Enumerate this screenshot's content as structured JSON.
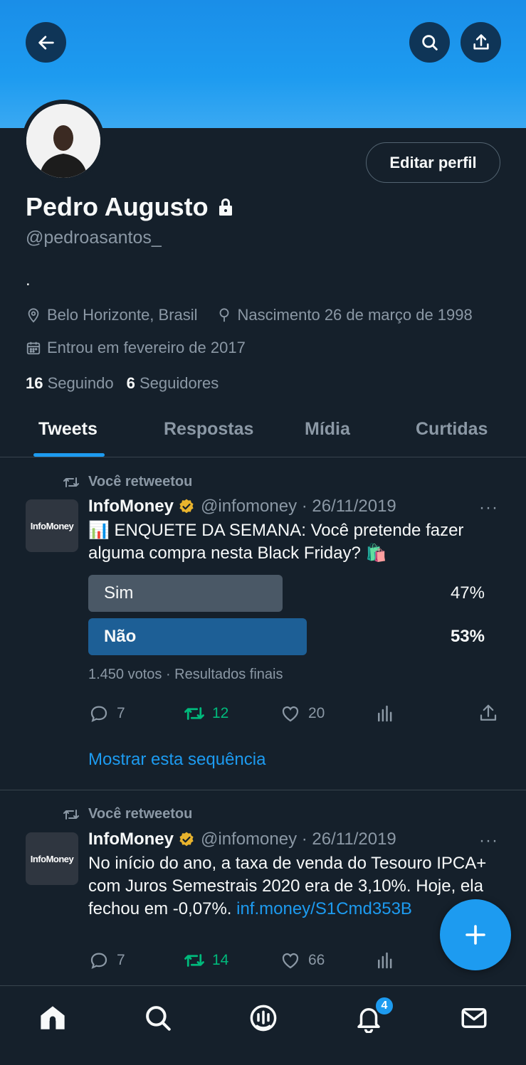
{
  "profile": {
    "name": "Pedro Augusto",
    "handle": "@pedroasantos_",
    "bio": ".",
    "location": "Belo Horizonte, Brasil",
    "birthday": "Nascimento 26 de março de 1998",
    "joined": "Entrou em fevereiro de 2017",
    "following_count": "16",
    "following_label": "Seguindo",
    "followers_count": "6",
    "followers_label": "Seguidores",
    "edit_label": "Editar perfil"
  },
  "tabs": [
    {
      "label": "Tweets",
      "active": true
    },
    {
      "label": "Respostas",
      "active": false
    },
    {
      "label": "Mídia",
      "active": false
    },
    {
      "label": "Curtidas",
      "active": false
    }
  ],
  "tweets": [
    {
      "retweet_label": "Você retweetou",
      "avatar_text": "InfoMoney",
      "author": "InfoMoney",
      "meta": "@infomoney · 26/11/2019",
      "more": "···",
      "text": "📊 ENQUETE DA SEMANA: Você pretende fazer alguma compra nesta Black Friday? 🛍️",
      "poll": {
        "options": [
          {
            "label": "Sim",
            "percent_label": "47%",
            "fraction": 0.47,
            "winner": false
          },
          {
            "label": "Não",
            "percent_label": "53%",
            "fraction": 0.53,
            "winner": true
          }
        ],
        "footer": "1.450 votos · Resultados finais"
      },
      "replies": "7",
      "retweets": "12",
      "likes": "20",
      "show_thread": "Mostrar esta sequência"
    },
    {
      "retweet_label": "Você retweetou",
      "avatar_text": "InfoMoney",
      "author": "InfoMoney",
      "meta": "@infomoney · 26/11/2019",
      "more": "···",
      "text": "No início do ano, a taxa de venda do Tesouro IPCA+ com Juros Semestrais 2020 era de 3,10%. Hoje, ela fechou em -0,07%.",
      "link": "inf.money/S1Cmd353B",
      "replies": "7",
      "retweets": "14",
      "likes": "66"
    }
  ],
  "notifications_badge": "4",
  "colors": {
    "accent": "#1d9bf0",
    "background": "#15202b",
    "retweet_green": "#00ba7c",
    "poll_winner": "#1d5f96",
    "poll_other": "#4a5866"
  }
}
